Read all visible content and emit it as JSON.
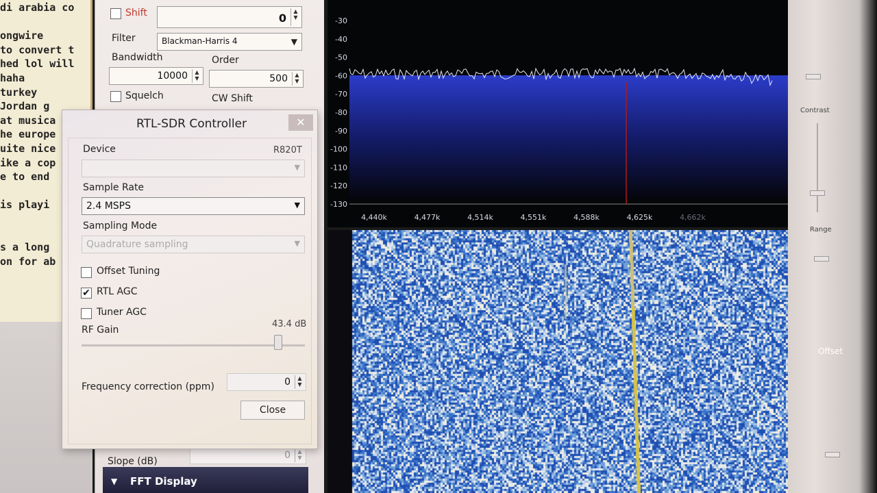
{
  "terminal": {
    "lines": [
      "di arabia co",
      "",
      "ongwire",
      "to convert t",
      "hed lol will",
      " haha",
      "turkey",
      " Jordan g",
      "at musica",
      "he europe",
      "uite nice",
      "ike a cop",
      "e to end",
      "",
      " is playi",
      "",
      "",
      "s a long",
      "on for ab"
    ]
  },
  "radio": {
    "shift_label": "Shift",
    "shift_value": "0",
    "filter_label": "Filter",
    "filter_value": "Blackman-Harris 4",
    "bandwidth_label": "Bandwidth",
    "bandwidth_value": "10000",
    "order_label": "Order",
    "order_value": "500",
    "squelch_label": "Squelch",
    "cw_shift_label": "CW Shift",
    "slope_label": "Slope (dB)",
    "slope_value": "0",
    "fft_display_label": "FFT Display"
  },
  "dialog": {
    "title": "RTL-SDR Controller",
    "close_x": "✕",
    "device_label": "Device",
    "device_name": "R820T",
    "device_value": "",
    "sample_rate_label": "Sample Rate",
    "sample_rate_value": "2.4 MSPS",
    "sampling_mode_label": "Sampling Mode",
    "sampling_mode_value": "Quadrature sampling",
    "offset_tuning_label": "Offset Tuning",
    "rtl_agc_label": "RTL AGC",
    "tuner_agc_label": "Tuner AGC",
    "rf_gain_label": "RF Gain",
    "rf_gain_value": "43.4 dB",
    "rf_gain_level": 0.88,
    "freq_corr_label": "Frequency correction (ppm)",
    "freq_corr_value": "0",
    "close_button": "Close",
    "checks": {
      "offset_tuning": false,
      "rtl_agc": true,
      "tuner_agc": false
    }
  },
  "spectrum": {
    "y_ticks": [
      "-30",
      "-40",
      "-50",
      "-60",
      "-70",
      "-80",
      "-90",
      "-100",
      "-110",
      "-120",
      "-130"
    ],
    "x_ticks": [
      "4,440k",
      "4,477k",
      "4,514k",
      "4,551k",
      "4,588k",
      "4,625k",
      "4,662k"
    ]
  },
  "side": {
    "contrast_label": "Contrast",
    "range_label": "Range",
    "offset_label": "Offset"
  }
}
